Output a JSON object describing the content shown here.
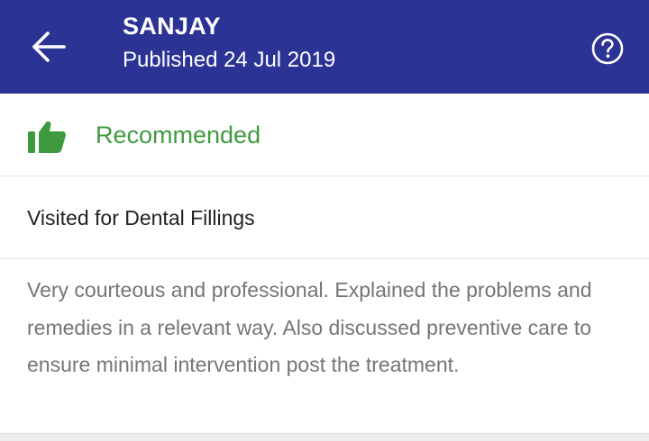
{
  "header": {
    "reviewer_name": "SANJAY",
    "published": "Published 24 Jul 2019",
    "back_icon": "arrow-left-icon",
    "help_icon": "question-circle-icon",
    "background_color": "#2b3394"
  },
  "recommendation": {
    "icon": "thumbs-up-icon",
    "label": "Recommended",
    "color": "#3f9a3f"
  },
  "visit": {
    "label": "Visited for Dental Fillings"
  },
  "review": {
    "text": "Very courteous and professional. Explained the problems and remedies in a relevant way. Also discussed preventive care to ensure minimal intervention post the treatment."
  }
}
